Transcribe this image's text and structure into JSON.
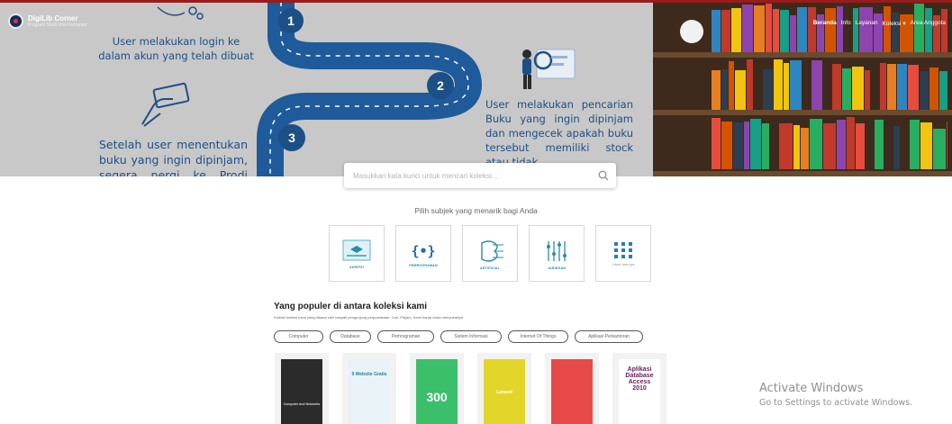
{
  "brand": {
    "name": "DigiLib Corner",
    "subtitle": "Program Studi Ilmu Komputer"
  },
  "nav": [
    "Beranda",
    "Info",
    "Layanan",
    "Koleksi",
    "Area Anggota"
  ],
  "hero": {
    "steps": [
      {
        "number": "1",
        "text": "User melakukan login ke dalam akun yang telah dibuat"
      },
      {
        "number": "2",
        "text": "User melakukan pencarian Buku yang ingin dipinjam dan mengecek apakah buku tersebut memiliki stock atau tidak"
      },
      {
        "number": "3",
        "text": "Setelah user menentukan buku yang ingin dipinjam, segera pergi ke Prodi untuk"
      }
    ]
  },
  "search": {
    "placeholder": "Masukkan kata kunci untuk mencari koleksi..."
  },
  "subjects": {
    "title": "Pilih subjek yang menarik bagi Anda",
    "items": [
      {
        "label": "SKRIPSI",
        "icon": "thesis-icon"
      },
      {
        "label": "PEMROGRAMAN",
        "icon": "code-brackets-icon"
      },
      {
        "label": "ARTIFICIAL",
        "icon": "ai-brain-icon"
      },
      {
        "label": "JARINGAN",
        "icon": "network-icon"
      },
      {
        "label": "Lihat lainnya",
        "icon": "grid-dots-icon"
      }
    ]
  },
  "popular": {
    "title": "Yang populer di antara koleksi kami",
    "description": "Koleksi koleksi kami yang dibaca oleh banyak pengunjung perpustakaan. Cari, Pinjam, Kami harap Anda menyukainya",
    "chips": [
      "Computer",
      "Database",
      "Pemrograman",
      "Sistem Informasi",
      "Internet Of Things",
      "Aplikasi Perkantoran"
    ],
    "books": [
      {
        "cover_text": "Computer and Networks",
        "bg": "#2b2b2b",
        "fg": "#d7d7d7"
      },
      {
        "cover_text": "9 Website Gratis",
        "bg": "#e9f2f6",
        "fg": "#1a8a9a"
      },
      {
        "cover_text": "300",
        "bg": "#3bbf6a",
        "fg": "#ffffff"
      },
      {
        "cover_text": "Laravel",
        "bg": "#e3d62a",
        "fg": "#ffffff"
      },
      {
        "cover_text": "",
        "bg": "#e84a4a",
        "fg": "#ffffff"
      },
      {
        "cover_text": "Aplikasi Database Access 2010",
        "bg": "#ffffff",
        "fg": "#6a1b5a"
      }
    ]
  },
  "windows_watermark": {
    "title": "Activate Windows",
    "subtitle": "Go to Settings to activate Windows."
  },
  "colors": {
    "accent_blue": "#1c4f86",
    "top_border": "#9a1b1b",
    "hero_bg": "#c8c8c8"
  }
}
